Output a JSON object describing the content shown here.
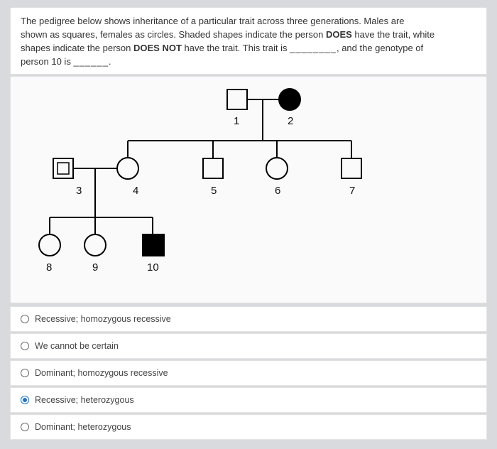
{
  "question": {
    "line1": "The pedigree below shows inheritance of a particular trait across three generations. Males are",
    "line2a": "shown as squares, females as circles. Shaded shapes indicate the person ",
    "does_label": "DOES",
    "line2b": " have the trait, white",
    "line3a": "shapes indicate the person ",
    "doesnot_label": "DOES NOT",
    "line3b": " have the trait. This trait is ",
    "blank1": "________",
    "line3c": ", and the genotype of",
    "line4a": "person 10 is ",
    "blank2": "______",
    "period": "."
  },
  "pedigree": {
    "labels": {
      "p1": "1",
      "p2": "2",
      "p3": "3",
      "p4": "4",
      "p5": "5",
      "p6": "6",
      "p7": "7",
      "p8": "8",
      "p9": "9",
      "p10": "10"
    },
    "nodes": [
      {
        "id": 1,
        "shape": "square",
        "filled": false
      },
      {
        "id": 2,
        "shape": "circle",
        "filled": true
      },
      {
        "id": 3,
        "shape": "square",
        "filled": false
      },
      {
        "id": 4,
        "shape": "circle",
        "filled": false
      },
      {
        "id": 5,
        "shape": "square",
        "filled": false
      },
      {
        "id": 6,
        "shape": "circle",
        "filled": false
      },
      {
        "id": 7,
        "shape": "square",
        "filled": false
      },
      {
        "id": 8,
        "shape": "circle",
        "filled": false
      },
      {
        "id": 9,
        "shape": "circle",
        "filled": false
      },
      {
        "id": 10,
        "shape": "square",
        "filled": true
      }
    ]
  },
  "options": [
    {
      "label": "Recessive; homozygous recessive",
      "selected": false
    },
    {
      "label": "We cannot be certain",
      "selected": false
    },
    {
      "label": "Dominant; homozygous recessive",
      "selected": false
    },
    {
      "label": "Recessive; heterozygous",
      "selected": true
    },
    {
      "label": "Dominant; heterozygous",
      "selected": false
    }
  ]
}
